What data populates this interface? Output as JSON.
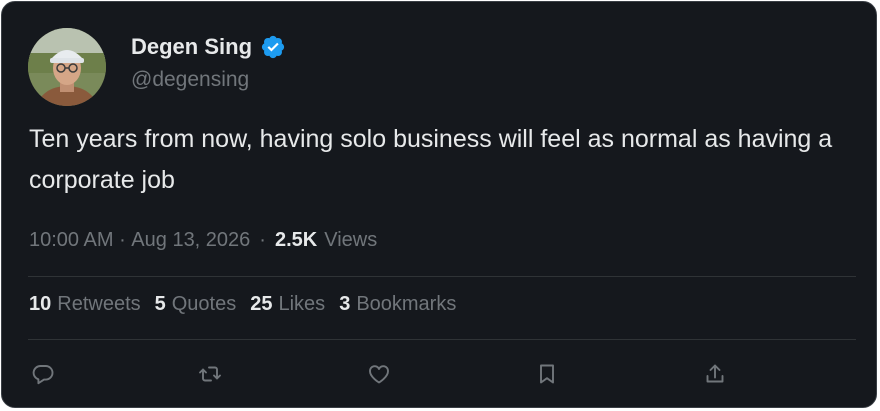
{
  "tweet": {
    "display_name": "Degen Sing",
    "handle": "@degensing",
    "verified": true,
    "text": "Ten years from now, having solo business will feel as normal as having a corporate job",
    "time": "10:00 AM",
    "date_sep": " · ",
    "date": "Aug 13, 2026",
    "dot": "·",
    "views_count": "2.5K",
    "views_label": "Views"
  },
  "stats": {
    "retweets": {
      "count": "10",
      "label": "Retweets"
    },
    "quotes": {
      "count": "5",
      "label": "Quotes"
    },
    "likes": {
      "count": "25",
      "label": "Likes"
    },
    "bookmarks": {
      "count": "3",
      "label": "Bookmarks"
    }
  },
  "actions": [
    "reply-icon",
    "retweet-icon",
    "like-icon",
    "bookmark-icon",
    "share-icon"
  ],
  "colors": {
    "background": "#15181d",
    "text": "#e7e9ea",
    "muted": "#71767b",
    "verified_blue": "#1d9bf0",
    "divider": "#2f3336"
  }
}
